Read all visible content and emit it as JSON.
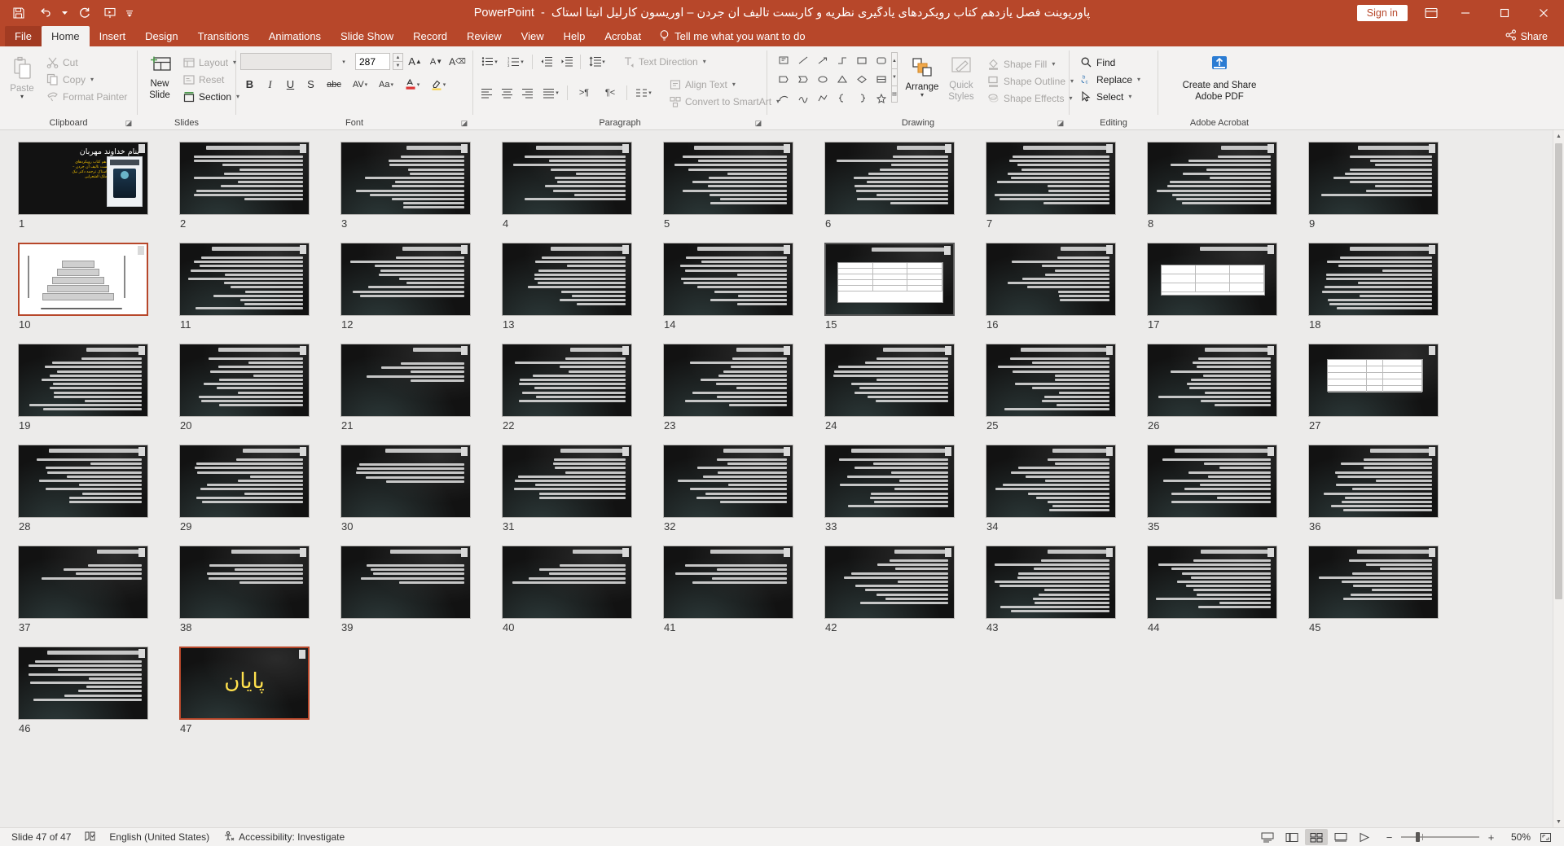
{
  "window": {
    "title": "پاورپوینت فصل یازدهم کتاب رویکردهای یادگیری نظریه و کاربست تالیف آن جردن – اوریسون کارلیل آنیتا استاک",
    "app_name": "PowerPoint",
    "title_separator": "-",
    "sign_in": "Sign in",
    "minimize": "−",
    "maximize": "□",
    "close": "✕"
  },
  "quick_access": [
    {
      "name": "save-icon",
      "label": "Save"
    },
    {
      "name": "undo-icon",
      "label": "Undo"
    },
    {
      "name": "redo-icon",
      "label": "Redo"
    },
    {
      "name": "start-presentation-icon",
      "label": "Start From Beginning"
    },
    {
      "name": "customize-qat-icon",
      "label": "Customize Quick Access Toolbar"
    }
  ],
  "tabs": [
    {
      "label": "File",
      "active": false,
      "file": true
    },
    {
      "label": "Home",
      "active": true,
      "file": false
    },
    {
      "label": "Insert",
      "active": false,
      "file": false
    },
    {
      "label": "Design",
      "active": false,
      "file": false
    },
    {
      "label": "Transitions",
      "active": false,
      "file": false
    },
    {
      "label": "Animations",
      "active": false,
      "file": false
    },
    {
      "label": "Slide Show",
      "active": false,
      "file": false
    },
    {
      "label": "Record",
      "active": false,
      "file": false
    },
    {
      "label": "Review",
      "active": false,
      "file": false
    },
    {
      "label": "View",
      "active": false,
      "file": false
    },
    {
      "label": "Help",
      "active": false,
      "file": false
    },
    {
      "label": "Acrobat",
      "active": false,
      "file": false
    }
  ],
  "tell_me": "Tell me what you want to do",
  "share": "Share",
  "ribbon": {
    "clipboard": {
      "label": "Clipboard",
      "paste": "Paste",
      "cut": "Cut",
      "copy": "Copy",
      "format_painter": "Format Painter"
    },
    "slides": {
      "label": "Slides",
      "new_slide": "New",
      "new_slide2": "Slide",
      "layout": "Layout",
      "reset": "Reset",
      "section": "Section"
    },
    "font": {
      "label": "Font",
      "font_name": "",
      "font_size": "287",
      "bold": "B",
      "italic": "I",
      "underline": "U",
      "shadow": "S",
      "strikethrough": "abc",
      "character_spacing": "AV",
      "change_case": "Aa",
      "grow_font": "A",
      "shrink_font": "A",
      "clear_formatting": "A"
    },
    "paragraph": {
      "label": "Paragraph",
      "text_direction": "Text Direction",
      "align_text": "Align Text",
      "convert_to_smartart": "Convert to SmartArt"
    },
    "drawing": {
      "label": "Drawing",
      "arrange": "Arrange",
      "quick_styles": "Quick",
      "quick_styles2": "Styles",
      "shape_fill": "Shape Fill",
      "shape_outline": "Shape Outline",
      "shape_effects": "Shape Effects"
    },
    "editing": {
      "label": "Editing",
      "find": "Find",
      "replace": "Replace",
      "select": "Select"
    },
    "acrobat": {
      "label": "Adobe Acrobat",
      "create_share": "Create and Share",
      "create_share2": "Adobe PDF"
    }
  },
  "slides": [
    {
      "n": "1",
      "type": "title",
      "selected": false
    },
    {
      "n": "2",
      "type": "text",
      "selected": false
    },
    {
      "n": "3",
      "type": "text",
      "selected": false
    },
    {
      "n": "4",
      "type": "text",
      "selected": false
    },
    {
      "n": "5",
      "type": "text",
      "selected": false
    },
    {
      "n": "6",
      "type": "text",
      "selected": false
    },
    {
      "n": "7",
      "type": "text",
      "selected": false
    },
    {
      "n": "8",
      "type": "text",
      "selected": false
    },
    {
      "n": "9",
      "type": "text",
      "selected": false
    },
    {
      "n": "10",
      "type": "stairs",
      "selected": true
    },
    {
      "n": "11",
      "type": "text",
      "selected": false
    },
    {
      "n": "12",
      "type": "text",
      "selected": false
    },
    {
      "n": "13",
      "type": "text",
      "selected": false
    },
    {
      "n": "14",
      "type": "text",
      "selected": false
    },
    {
      "n": "15",
      "type": "table",
      "selected": true
    },
    {
      "n": "16",
      "type": "text",
      "selected": false
    },
    {
      "n": "17",
      "type": "table2",
      "selected": false
    },
    {
      "n": "18",
      "type": "text",
      "selected": false
    },
    {
      "n": "19",
      "type": "text",
      "selected": false
    },
    {
      "n": "20",
      "type": "text",
      "selected": false
    },
    {
      "n": "21",
      "type": "sparse",
      "selected": false
    },
    {
      "n": "22",
      "type": "text",
      "selected": false
    },
    {
      "n": "23",
      "type": "text",
      "selected": false
    },
    {
      "n": "24",
      "type": "text",
      "selected": false
    },
    {
      "n": "25",
      "type": "text",
      "selected": false
    },
    {
      "n": "26",
      "type": "text",
      "selected": false
    },
    {
      "n": "27",
      "type": "table3",
      "selected": false
    },
    {
      "n": "28",
      "type": "text",
      "selected": false
    },
    {
      "n": "29",
      "type": "text",
      "selected": false
    },
    {
      "n": "30",
      "type": "sparse",
      "selected": false
    },
    {
      "n": "31",
      "type": "text",
      "selected": false
    },
    {
      "n": "32",
      "type": "text",
      "selected": false
    },
    {
      "n": "33",
      "type": "text",
      "selected": false
    },
    {
      "n": "34",
      "type": "text",
      "selected": false
    },
    {
      "n": "35",
      "type": "text",
      "selected": false
    },
    {
      "n": "36",
      "type": "text",
      "selected": false
    },
    {
      "n": "37",
      "type": "sparse",
      "selected": false
    },
    {
      "n": "38",
      "type": "sparse",
      "selected": false
    },
    {
      "n": "39",
      "type": "sparse",
      "selected": false
    },
    {
      "n": "40",
      "type": "sparse",
      "selected": false
    },
    {
      "n": "41",
      "type": "sparse",
      "selected": false
    },
    {
      "n": "42",
      "type": "text",
      "selected": false
    },
    {
      "n": "43",
      "type": "text",
      "selected": false
    },
    {
      "n": "44",
      "type": "text",
      "selected": false
    },
    {
      "n": "45",
      "type": "text",
      "selected": false
    },
    {
      "n": "46",
      "type": "text",
      "selected": false
    },
    {
      "n": "47",
      "type": "payan",
      "selected": true
    }
  ],
  "slide_1": {
    "title": "بنام خداوند مهربان",
    "body": "پاورپوینت فصل یازدهم کتاب رویکردهای یادگیری نظریه و کاربست تالیف آن جردن – اوریسون کارلیل آنیتا استاک ترجمه دکتر نیک نشان و دکتر ملک الشعرایی"
  },
  "slide_47": {
    "text": "پایان"
  },
  "status": {
    "slide_counter": "Slide 47 of 47",
    "language": "English (United States)",
    "accessibility": "Accessibility: Investigate",
    "zoom_value": "50%",
    "notes_icon": "notes-icon",
    "views": [
      "normal-view",
      "slide-sorter-view",
      "reading-view",
      "slide-show-view"
    ],
    "active_view": "slide-sorter-view"
  }
}
